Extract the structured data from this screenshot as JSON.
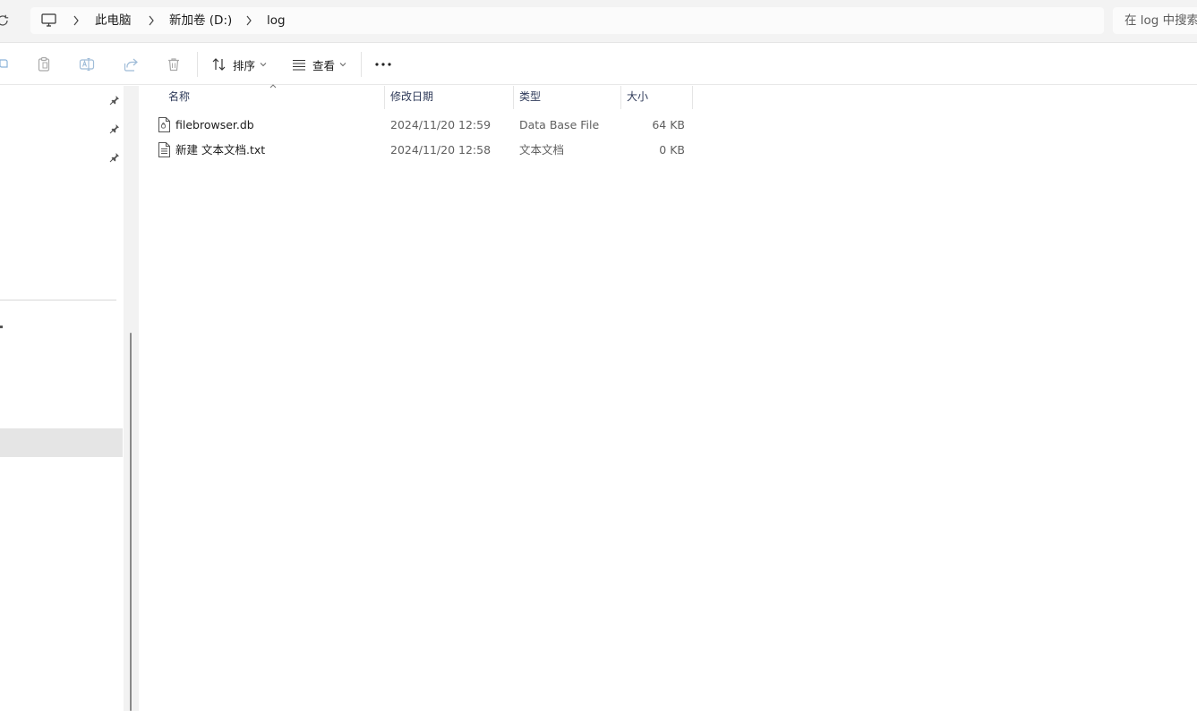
{
  "address_bar": {
    "crumbs": [
      "此电脑",
      "新加卷 (D:)",
      "log"
    ]
  },
  "search": {
    "placeholder": "在 log 中搜索"
  },
  "command_bar": {
    "sort_label": "排序",
    "view_label": "查看",
    "icons": [
      "new-icon",
      "paste-icon",
      "rename-icon",
      "share-icon",
      "delete-icon",
      "sort-icon",
      "view-icon",
      "more-icon"
    ]
  },
  "file_list": {
    "columns": [
      "名称",
      "修改日期",
      "类型",
      "大小"
    ],
    "sorted_by": "名称",
    "rows": [
      {
        "name": "filebrowser.db",
        "modified": "2024/11/20 12:59",
        "type": "Data Base File",
        "size": "64 KB",
        "icon": "db-file-icon"
      },
      {
        "name": "新建 文本文档.txt",
        "modified": "2024/11/20 12:58",
        "type": "文本文档",
        "size": "0 KB",
        "icon": "text-file-icon"
      }
    ]
  },
  "colors": {
    "toolbar_bg": "#f3f3f3",
    "selected_nav_bg": "#e5e5e5",
    "column_header_text": "#2e3a59",
    "secondary_text": "#5f5f5f"
  }
}
